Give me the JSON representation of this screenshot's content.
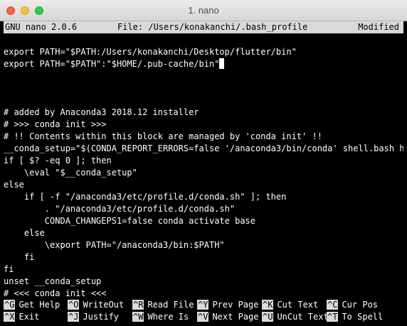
{
  "window": {
    "title": "1. nano",
    "buttons": [
      "close",
      "minimize",
      "zoom"
    ]
  },
  "nano_header": {
    "version": "GNU nano 2.0.6",
    "file": "File: /Users/konakanchi/.bash_profile",
    "status": "Modified"
  },
  "editor_lines": [
    "",
    "export PATH=\"$PATH:/Users/konakanchi/Desktop/flutter/bin\"",
    "export PATH=\"$PATH\":\"$HOME/.pub-cache/bin\"",
    "",
    "",
    "",
    "# added by Anaconda3 2018.12 installer",
    "# >>> conda init >>>",
    "# !! Contents within this block are managed by 'conda init' !!",
    "__conda_setup=\"$(CONDA_REPORT_ERRORS=false '/anaconda3/bin/conda' shell.bash ho$",
    "if [ $? -eq 0 ]; then",
    "    \\eval \"$__conda_setup\"",
    "else",
    "    if [ -f \"/anaconda3/etc/profile.d/conda.sh\" ]; then",
    "        . \"/anaconda3/etc/profile.d/conda.sh\"",
    "        CONDA_CHANGEPS1=false conda activate base",
    "    else",
    "        \\export PATH=\"/anaconda3/bin:$PATH\"",
    "    fi",
    "fi",
    "unset __conda_setup",
    "# <<< conda init <<<"
  ],
  "cursor_line": 2,
  "shortcuts_row1": [
    {
      "key": "^G",
      "label": "Get Help"
    },
    {
      "key": "^O",
      "label": "WriteOut"
    },
    {
      "key": "^R",
      "label": "Read File"
    },
    {
      "key": "^Y",
      "label": "Prev Page"
    },
    {
      "key": "^K",
      "label": "Cut Text"
    },
    {
      "key": "^C",
      "label": "Cur Pos"
    }
  ],
  "shortcuts_row2": [
    {
      "key": "^X",
      "label": "Exit"
    },
    {
      "key": "^J",
      "label": "Justify"
    },
    {
      "key": "^W",
      "label": "Where Is"
    },
    {
      "key": "^V",
      "label": "Next Page"
    },
    {
      "key": "^U",
      "label": "UnCut Text"
    },
    {
      "key": "^T",
      "label": "To Spell"
    }
  ]
}
